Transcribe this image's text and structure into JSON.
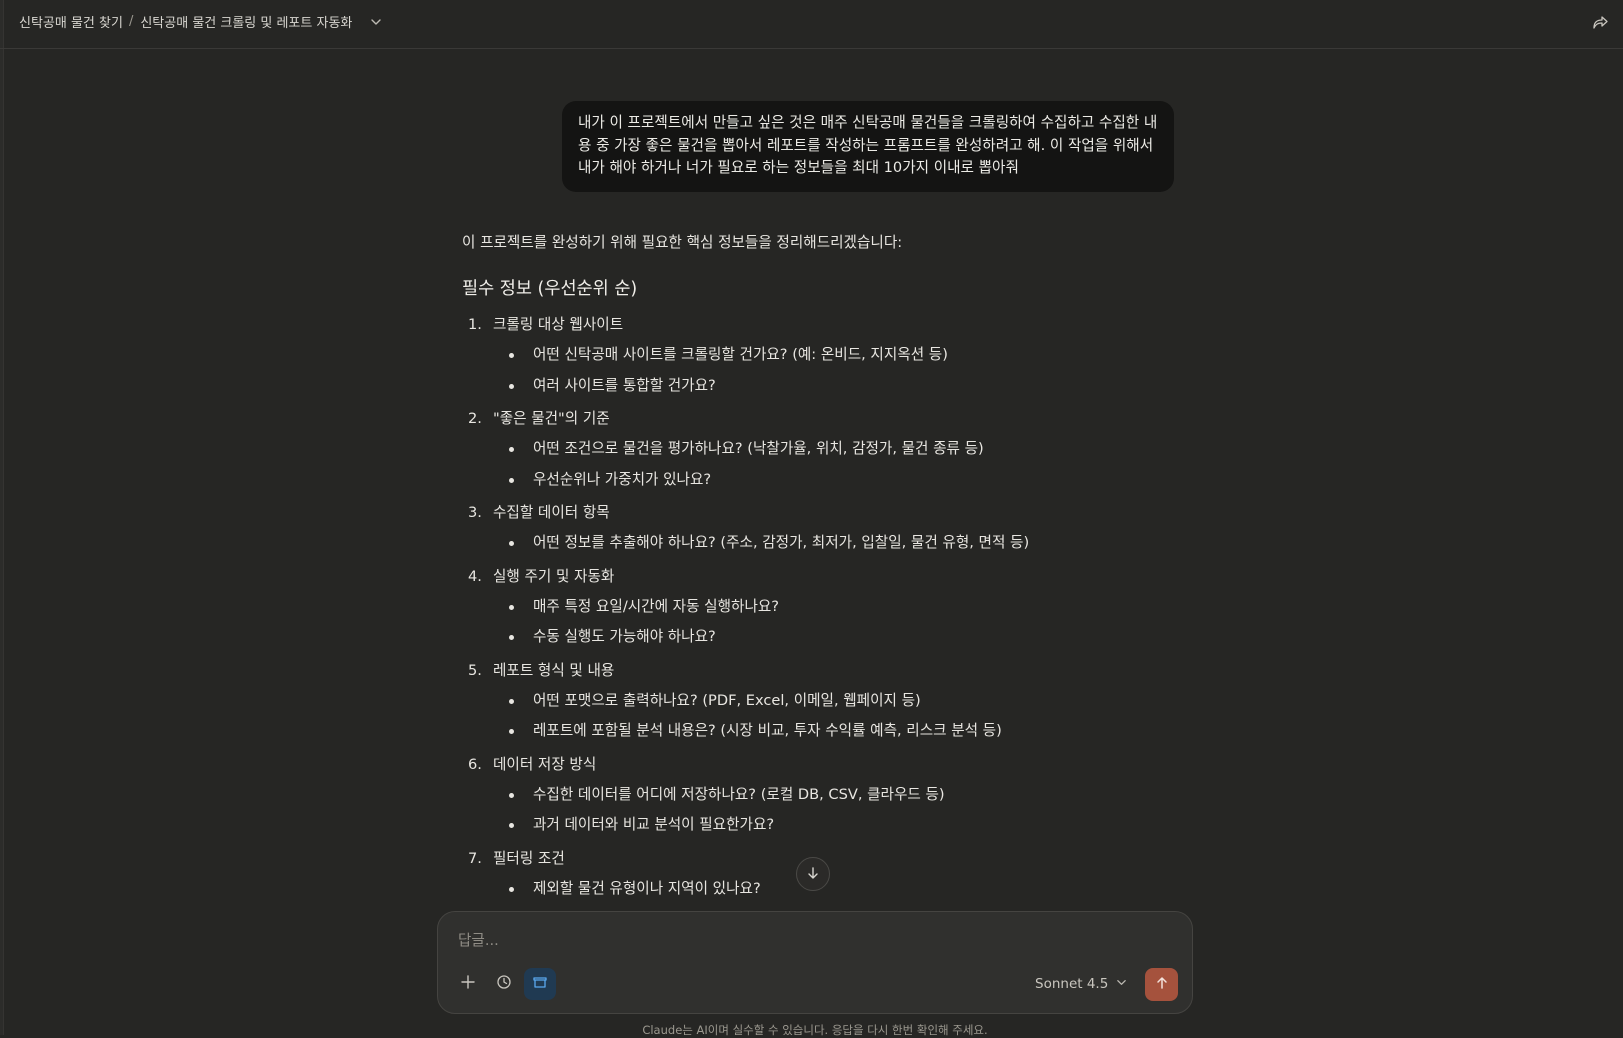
{
  "header": {
    "project": "신탁공매 물건 찾기",
    "separator": "/",
    "chat_title": "신탁공매 물건 크롤링 및 레포트 자동화"
  },
  "user_message": "내가 이 프로젝트에서 만들고 싶은 것은 매주 신탁공매 물건들을 크롤링하여 수집하고 수집한 내용 중 가장 좋은 물건을 뽑아서 레포트를 작성하는 프롬프트를 완성하려고 해. 이 작업을 위해서 내가 해야 하거나 너가 필요로 하는 정보들을 최대 10가지 이내로 뽑아줘",
  "assistant": {
    "intro": "이 프로젝트를 완성하기 위해 필요한 핵심 정보들을 정리해드리겠습니다:",
    "section_title": "필수 정보 (우선순위 순)",
    "items": [
      {
        "num": "1.",
        "title": "크롤링 대상 웹사이트",
        "subs": [
          "어떤 신탁공매 사이트를 크롤링할 건가요? (예: 온비드, 지지옥션 등)",
          "여러 사이트를 통합할 건가요?"
        ]
      },
      {
        "num": "2.",
        "title": "\"좋은 물건\"의 기준",
        "subs": [
          "어떤 조건으로 물건을 평가하나요? (낙찰가율, 위치, 감정가, 물건 종류 등)",
          "우선순위나 가중치가 있나요?"
        ]
      },
      {
        "num": "3.",
        "title": "수집할 데이터 항목",
        "subs": [
          "어떤 정보를 추출해야 하나요? (주소, 감정가, 최저가, 입찰일, 물건 유형, 면적 등)"
        ]
      },
      {
        "num": "4.",
        "title": "실행 주기 및 자동화",
        "subs": [
          "매주 특정 요일/시간에 자동 실행하나요?",
          "수동 실행도 가능해야 하나요?"
        ]
      },
      {
        "num": "5.",
        "title": "레포트 형식 및 내용",
        "subs": [
          "어떤 포맷으로 출력하나요? (PDF, Excel, 이메일, 웹페이지 등)",
          "레포트에 포함될 분석 내용은? (시장 비교, 투자 수익률 예측, 리스크 분석 등)"
        ]
      },
      {
        "num": "6.",
        "title": "데이터 저장 방식",
        "subs": [
          "수집한 데이터를 어디에 저장하나요? (로컬 DB, CSV, 클라우드 등)",
          "과거 데이터와 비교 분석이 필요한가요?"
        ]
      },
      {
        "num": "7.",
        "title": "필터링 조건",
        "subs": [
          "제외할 물건 유형이나 지역이 있나요?"
        ]
      }
    ]
  },
  "composer": {
    "placeholder": "답글...",
    "model": "Sonnet 4.5"
  },
  "disclaimer": "Claude는 AI이며 실수할 수 있습니다. 응답을 다시 한번 확인해 주세요.",
  "colors": {
    "background": "#262624",
    "user_bubble": "#141413",
    "send_button": "#a5523d",
    "research_active": "#203a52"
  }
}
